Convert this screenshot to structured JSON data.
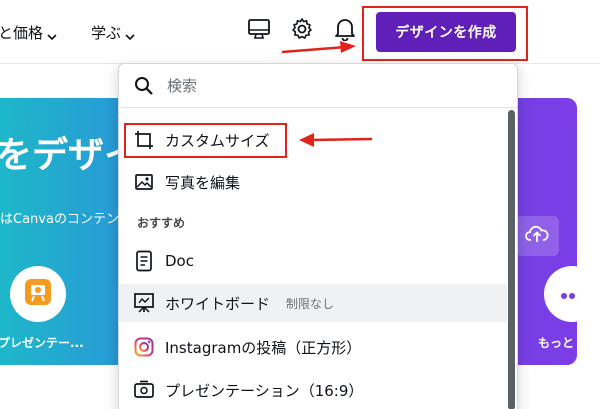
{
  "topbar": {
    "nav1_label": "と価格",
    "nav2_label": "学ぶ",
    "create_button": "デザインを作成"
  },
  "banner": {
    "title": "をデザイ",
    "subtitle": "はCanvaのコンテン",
    "left_label": "プレゼンテー...",
    "right_label": "もっと"
  },
  "dropdown": {
    "search_placeholder": "検索",
    "custom_size": "カスタムサイズ",
    "edit_photo": "写真を編集",
    "section_recommended": "おすすめ",
    "items": [
      {
        "label": "Doc"
      },
      {
        "label": "ホワイトボード",
        "note": "制限なし"
      },
      {
        "label": "Instagramの投稿（正方形）"
      },
      {
        "label": "プレゼンテーション（16:9）"
      }
    ]
  },
  "colors": {
    "accent": "#5f1fb8",
    "annotation": "#e2231a"
  }
}
